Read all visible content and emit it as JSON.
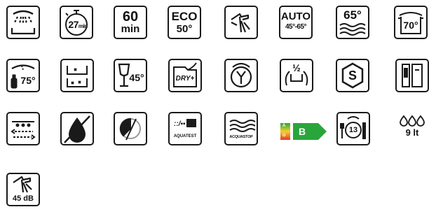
{
  "icons": {
    "prewash": {
      "icon": "shower-spray-icon"
    },
    "quick27": {
      "icon": "stopwatch-icon",
      "value": "27",
      "unit": "min"
    },
    "min60": {
      "value": "60",
      "unit": "min"
    },
    "eco50": {
      "line1": "ECO",
      "line2": "50°"
    },
    "silent": {
      "icon": "hand-finger-icon"
    },
    "auto": {
      "line1": "AUTO",
      "line2": "45°-65°"
    },
    "temp65": {
      "value": "65°",
      "icon": "waves-icon"
    },
    "pot70": {
      "icon": "pot-icon",
      "value": "70°"
    },
    "bottle75": {
      "icon": "baby-bottle-icon",
      "value": "75°"
    },
    "baskets": {
      "icon": "upper-lower-basket-icon"
    },
    "glass45": {
      "icon": "wine-glass-icon",
      "value": "45°"
    },
    "dryplus": {
      "value": "DRY+"
    },
    "timer": {
      "icon": "clock-timer-icon"
    },
    "halfload": {
      "value": "½",
      "icon": "half-load-icon"
    },
    "sanitize": {
      "value": "S",
      "icon": "hexagon-s-icon"
    },
    "fridge": {
      "icon": "appliance-panel-icon"
    },
    "spray_arms": {
      "icon": "spray-arms-icon"
    },
    "rinse_aid": {
      "icon": "drop-icon"
    },
    "salt": {
      "icon": "salt-gauge-icon"
    },
    "aquatest": {
      "label": "AQUATEST",
      "icon": "aquatest-sensor-icon"
    },
    "acquastop": {
      "label": "ACQUASTOP",
      "icon": "waves-icon"
    },
    "energy": {
      "scale_top": "A",
      "scale_bottom": "G",
      "rating": "B",
      "color": "#2aa53b"
    },
    "place_settings": {
      "value": "13",
      "icon": "plate-cutlery-icon"
    },
    "water": {
      "icon": "water-drops-icon",
      "value": "9 lt"
    },
    "noise": {
      "icon": "hand-finger-icon",
      "value": "45 dB"
    }
  },
  "colors": {
    "stroke": "#1a1a1a",
    "energy_green": "#2aa53b"
  }
}
